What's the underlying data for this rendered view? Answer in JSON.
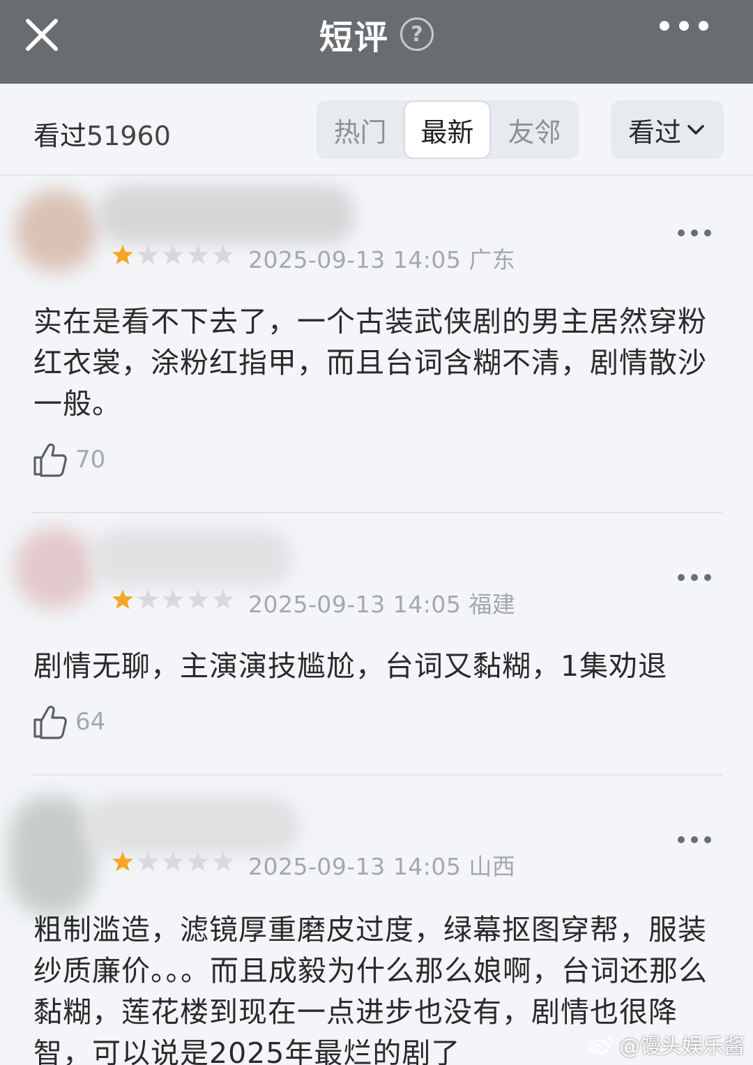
{
  "header": {
    "title": "短评",
    "help_glyph": "?"
  },
  "filter": {
    "seen_label": "看过",
    "seen_count": "51960",
    "tabs": [
      {
        "label": "热门",
        "active": false
      },
      {
        "label": "最新",
        "active": true
      },
      {
        "label": "友邻",
        "active": false
      }
    ],
    "sort_label": "看过"
  },
  "reviews": [
    {
      "rating": 1,
      "max_rating": 5,
      "date": "2025-09-13 14:05",
      "location": "广东",
      "text": "实在是看不下去了，一个古装武侠剧的男主居然穿粉红衣裳，涂粉红指甲，而且台词含糊不清，剧情散沙一般。",
      "likes": "70"
    },
    {
      "rating": 1,
      "max_rating": 5,
      "date": "2025-09-13 14:05",
      "location": "福建",
      "text": "剧情无聊，主演演技尴尬，台词又黏糊，1集劝退",
      "likes": "64"
    },
    {
      "rating": 1,
      "max_rating": 5,
      "date": "2025-09-13 14:05",
      "location": "山西",
      "text": "粗制滥造，滤镜厚重磨皮过度，绿幕抠图穿帮，服装纱质廉价。。。而且成毅为什么那么娘啊，台词还那么黏糊，莲花楼到现在一点进步也没有，剧情也很降智，可以说是2025年最烂的剧了",
      "likes": ""
    }
  ],
  "watermark": "@馒头娱乐酱",
  "colors": {
    "topbar": "#6a6d70",
    "star_filled": "#f5a623",
    "star_empty": "#d7d9dc",
    "page_bg": "#f3f5f8"
  }
}
